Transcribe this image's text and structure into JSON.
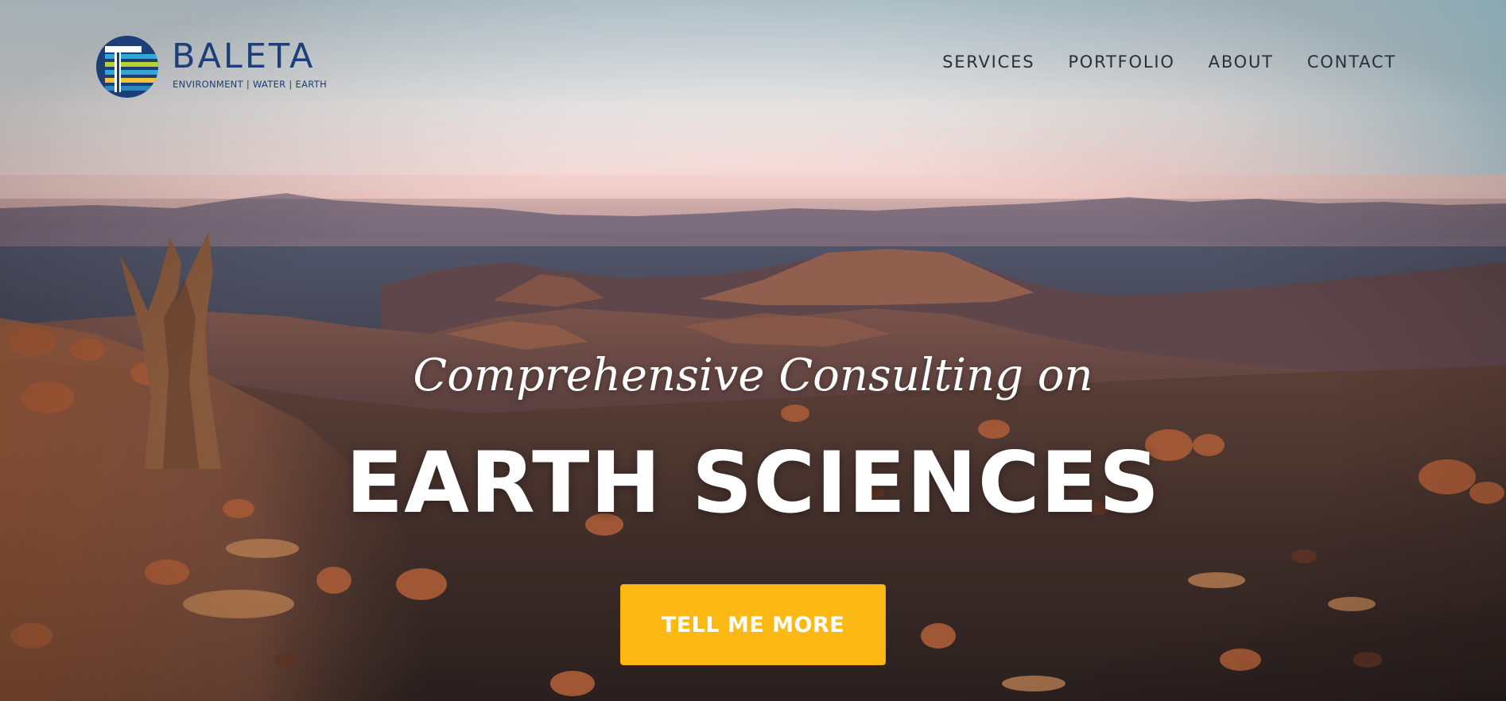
{
  "brand": {
    "name": "BALETA",
    "tagline": "ENVIRONMENT | WATER | EARTH",
    "logo_icon": "baleta-logo-icon",
    "colors": {
      "navy": "#1d3f78",
      "teal": "#33a6d8",
      "lime": "#b6d334",
      "gold": "#f2c43a"
    }
  },
  "nav": {
    "items": [
      {
        "label": "SERVICES"
      },
      {
        "label": "PORTFOLIO"
      },
      {
        "label": "ABOUT"
      },
      {
        "label": "CONTACT"
      }
    ]
  },
  "hero": {
    "subheading": "Comprehensive Consulting on",
    "heading": "EARTH SCIENCES",
    "cta_label": "TELL ME MORE",
    "background": "desert-landscape-at-sunset",
    "colors": {
      "cta": "#fdb913",
      "text": "#ffffff"
    }
  }
}
